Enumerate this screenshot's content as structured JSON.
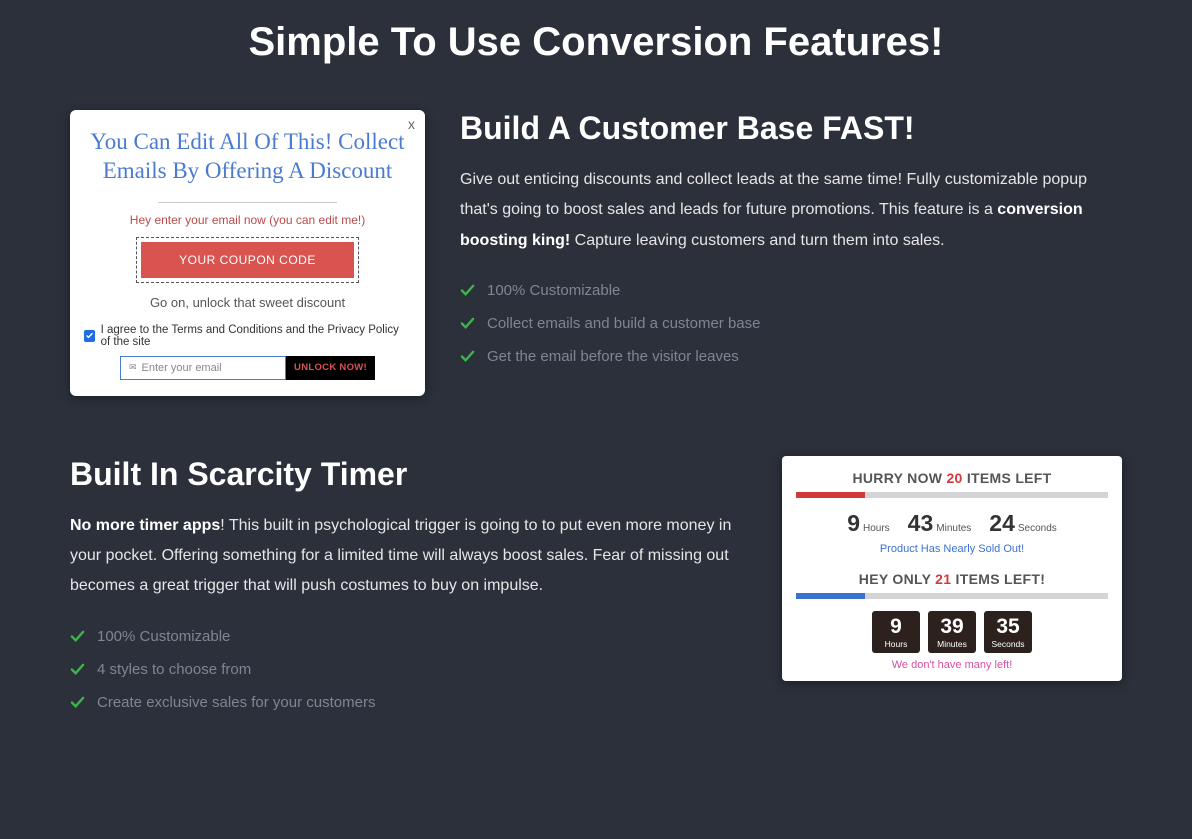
{
  "page_title": "Simple To Use Conversion Features!",
  "section1": {
    "heading": "Build A Customer Base FAST!",
    "body_pre": "Give out enticing discounts and collect leads at the same time! Fully customizable popup that's going to boost sales and leads for future promotions. This feature is a ",
    "body_bold": "conversion boosting king!",
    "body_post": " Capture leaving customers and turn them into sales.",
    "bullets": [
      "100% Customizable",
      "Collect emails and build a customer base",
      "Get the email before the visitor leaves"
    ]
  },
  "popup": {
    "title": "You Can Edit All Of This! Collect Emails By Offering A Discount",
    "hint": "Hey enter your email now (you can edit me!)",
    "coupon_label": "YOUR COUPON CODE",
    "sub": "Go on, unlock that sweet discount",
    "agree": "I agree to the Terms and Conditions and the Privacy Policy of the site",
    "placeholder": "Enter your email",
    "unlock_label": "UNLOCK NOW!",
    "close": "x"
  },
  "section2": {
    "heading": "Built In Scarcity Timer",
    "body_bold_pre": "No more timer apps",
    "body_post": "! This built in psychological trigger is going to to put even more money in your pocket. Offering something for a limited time will always boost sales. Fear of missing out becomes a great trigger that will push costumes to buy on impulse.",
    "bullets": [
      "100% Customizable",
      "4 styles to choose from",
      "Create exclusive sales for your customers"
    ]
  },
  "timer": {
    "head1_pre": "HURRY NOW ",
    "head1_num": "20",
    "head1_post": " ITEMS LEFT",
    "t1_h": "9",
    "t1_h_l": "Hours",
    "t1_m": "43",
    "t1_m_l": "Minutes",
    "t1_s": "24",
    "t1_s_l": "Seconds",
    "sub1": "Product Has Nearly Sold Out!",
    "head2_pre": "HEY ONLY ",
    "head2_num": "21",
    "head2_post": " ITEMS LEFT!",
    "t2_h": "9",
    "t2_h_l": "Hours",
    "t2_m": "39",
    "t2_m_l": "Minutes",
    "t2_s": "35",
    "t2_s_l": "Seconds",
    "sub2": "We don't have many left!"
  }
}
